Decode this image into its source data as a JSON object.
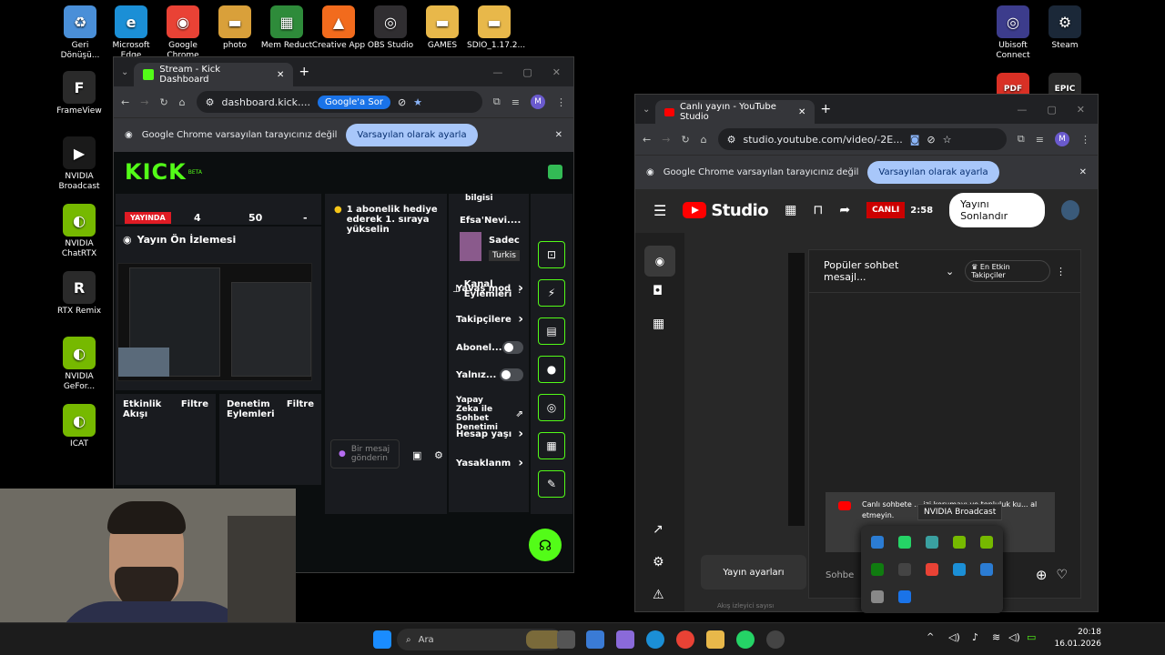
{
  "desktop": {
    "icons": [
      {
        "label": "Geri Dönüşü...",
        "color": "#4a8fd8",
        "glyph": "♻"
      },
      {
        "label": "Microsoft Edge",
        "color": "#1b8fd6",
        "glyph": "e"
      },
      {
        "label": "Google Chrome",
        "color": "#e94235",
        "glyph": "◉"
      },
      {
        "label": "photo",
        "color": "#d9a03a",
        "glyph": "▬"
      },
      {
        "label": "Mem Reduct",
        "color": "#2e8b3a",
        "glyph": "▦"
      },
      {
        "label": "Creative App",
        "color": "#f26b1d",
        "glyph": "▲"
      },
      {
        "label": "OBS Studio",
        "color": "#302e31",
        "glyph": "◎"
      },
      {
        "label": "GAMES",
        "color": "#e8b84a",
        "glyph": "▬"
      },
      {
        "label": "SDIO_1.17.2...",
        "color": "#e8b84a",
        "glyph": "▬"
      },
      {
        "label": "FrameView",
        "color": "#2a2a2a",
        "glyph": "F"
      },
      {
        "label": "NVIDIA Broadcast",
        "color": "#1a1a1a",
        "glyph": "▶"
      },
      {
        "label": "NVIDIA ChatRTX",
        "color": "#76b900",
        "glyph": "◐"
      },
      {
        "label": "RTX Remix",
        "color": "#2a2a2a",
        "glyph": "R"
      },
      {
        "label": "NVIDIA GeFor...",
        "color": "#76b900",
        "glyph": "◐"
      },
      {
        "label": "ICAT",
        "color": "#76b900",
        "glyph": "◐"
      },
      {
        "label": "Ubisoft Connect",
        "color": "#3c3c8c",
        "glyph": "◎"
      },
      {
        "label": "Steam",
        "color": "#1b2838",
        "glyph": "⚙"
      },
      {
        "label": "PDF",
        "color": "#d93025",
        "glyph": "PDF"
      },
      {
        "label": "EPIC GAMES",
        "color": "#2a2a2a",
        "glyph": "EPIC"
      }
    ]
  },
  "kick_window": {
    "tab_title": "Stream - Kick Dashboard",
    "url": "dashboard.kick....",
    "ask_google": "Google'a Sor",
    "avatar": "M",
    "infobar_text": "Google Chrome varsayılan tarayıcınız değil",
    "infobar_button": "Varsayılan olarak ayarla",
    "logo": "KICK",
    "logo_badge": "BETA",
    "live_badge": "YAYINDA",
    "stat_1": "4",
    "stat_2": "50",
    "stat_3": "-",
    "preview_title": "Yayın Ön İzlemesi",
    "activity_title": "Etkinlik Akışı",
    "activity_filter": "Filtre",
    "audit_title": "Denetim Eylemleri",
    "audit_filter": "Filtre",
    "chat_event": "1 abonelik hediye ederek 1. sıraya yükselin",
    "chat_placeholder": "Bir mesaj gönderin",
    "info_top": "bilgisi",
    "user_name": "Efsa'Nevi....",
    "user_line": "Sadec",
    "user_tag": "Turkis",
    "channel_actions": "Kanal Eylemleri",
    "menu": [
      {
        "label": "Yavaş mod",
        "kind": "arrow"
      },
      {
        "label": "Takipçilere",
        "kind": "arrow"
      },
      {
        "label": "Abonel...",
        "kind": "toggle"
      },
      {
        "label": "Yalnız...",
        "kind": "toggle"
      },
      {
        "label": "Yapay Zeka ile Sohbet Denetimi",
        "kind": "chart"
      },
      {
        "label": "Hesap yaşı",
        "kind": "arrow"
      },
      {
        "label": "Yasaklanm",
        "kind": "arrow"
      }
    ]
  },
  "yt_window": {
    "tab_title": "Canlı yayın - YouTube Studio",
    "url": "studio.youtube.com/video/-2E...",
    "avatar": "M",
    "infobar_text": "Google Chrome varsayılan tarayıcınız değil",
    "infobar_button": "Varsayılan olarak ayarla",
    "logo": "Studio",
    "live_badge": "CANLI",
    "live_time": "2:58",
    "end_button": "Yayını Sonlandır",
    "chat_mode": "Popüler sohbet mesajl...",
    "top_fans": "En Etkin Takipçiler",
    "notice_text": "Canlı sohbete ... izi korumayı ve topluluk ku... al etmeyin.",
    "stream_settings": "Yayın ayarları",
    "chat_input": "Sohbe",
    "below_text": "Akış izleyici sayısı"
  },
  "tray": {
    "tooltip": "NVIDIA Broadcast"
  },
  "taskbar": {
    "search": "Ara",
    "time": "20:18",
    "date": "16.01.2026"
  }
}
